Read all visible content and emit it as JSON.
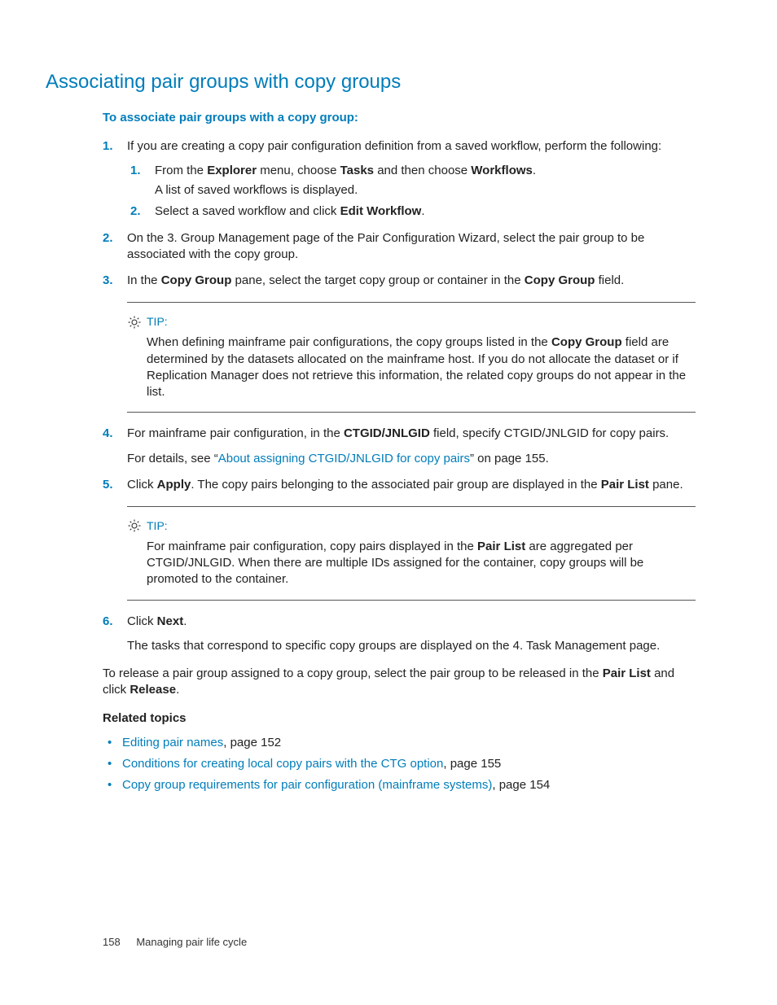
{
  "title": "Associating pair groups with copy groups",
  "intro": "To associate pair groups with a copy group:",
  "steps": {
    "s1": {
      "num": "1.",
      "text_a": "If you are creating a copy pair configuration definition from a saved workflow, perform the following:",
      "sub": {
        "a": {
          "num": "1.",
          "pre": "From the ",
          "b1": "Explorer",
          "mid1": " menu, choose ",
          "b2": "Tasks",
          "mid2": " and then choose ",
          "b3": "Workflows",
          "post": ".",
          "line2": "A list of saved workflows is displayed."
        },
        "b": {
          "num": "2.",
          "pre": "Select a saved workflow and click ",
          "b1": "Edit Workflow",
          "post": "."
        }
      }
    },
    "s2": {
      "num": "2.",
      "text": "On the 3. Group Management page of the Pair Configuration Wizard, select the pair group to be associated with the copy group."
    },
    "s3": {
      "num": "3.",
      "pre": "In the ",
      "b1": "Copy Group",
      "mid": " pane, select the target copy group or container in the ",
      "b2": "Copy Group",
      "post": " field."
    },
    "s4": {
      "num": "4.",
      "pre": "For mainframe pair configuration, in the ",
      "b1": "CTGID/JNLGID",
      "post": " field, specify CTGID/JNLGID for copy pairs.",
      "detail_pre": "For details, see “",
      "detail_link": "About assigning CTGID/JNLGID for copy pairs",
      "detail_post": "” on page 155."
    },
    "s5": {
      "num": "5.",
      "pre": "Click ",
      "b1": "Apply",
      "mid": ". The copy pairs belonging to the associated pair group are displayed in the ",
      "b2": "Pair List",
      "post": " pane."
    },
    "s6": {
      "num": "6.",
      "pre": "Click ",
      "b1": "Next",
      "post": ".",
      "line2": "The tasks that correspond to specific copy groups are displayed on the 4. Task Management page."
    }
  },
  "tip1": {
    "label": "TIP:",
    "pre": "When defining mainframe pair configurations, the copy groups listed in the ",
    "b1": "Copy Group",
    "post": " field are determined by the datasets allocated on the mainframe host. If you do not allocate the dataset or if Replication Manager does not retrieve this information, the related copy groups do not appear in the list."
  },
  "tip2": {
    "label": "TIP:",
    "pre": "For mainframe pair configuration, copy pairs displayed in the ",
    "b1": "Pair List",
    "post": " are aggregated per CTGID/JNLGID. When there are multiple IDs assigned for the container, copy groups will be promoted to the container."
  },
  "release": {
    "pre": "To release a pair group assigned to a copy group, select the pair group to be released in the ",
    "b1": "Pair List",
    "mid": " and click ",
    "b2": "Release",
    "post": "."
  },
  "related_head": "Related topics",
  "related": [
    {
      "link": "Editing pair names",
      "suffix": ", page 152"
    },
    {
      "link": "Conditions for creating local copy pairs with the CTG option",
      "suffix": ", page 155"
    },
    {
      "link": "Copy group requirements for pair configuration (mainframe systems)",
      "suffix": ", page 154"
    }
  ],
  "footer": {
    "page": "158",
    "chapter": "Managing pair life cycle"
  }
}
